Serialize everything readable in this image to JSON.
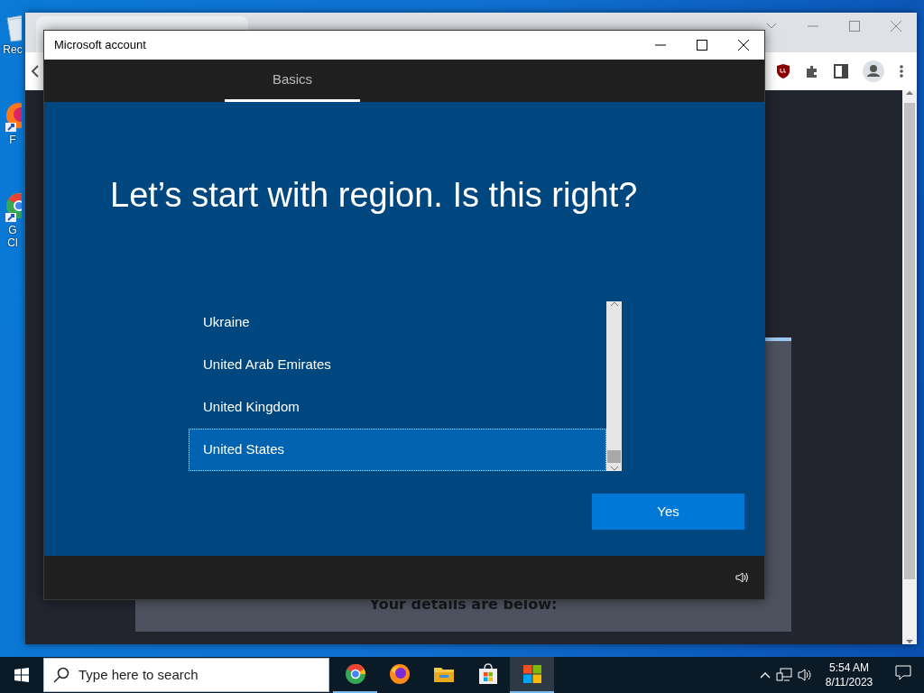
{
  "desktop_icons": [
    {
      "kind": "recycle",
      "lines": [
        "Rec"
      ]
    },
    {
      "kind": "firefox",
      "lines": [
        "F"
      ]
    },
    {
      "kind": "chrome",
      "lines": [
        "G",
        "Cl"
      ]
    }
  ],
  "browser_page": {
    "heading": "Your details are below:"
  },
  "dialog": {
    "title": "Microsoft account",
    "tabs": [
      {
        "label": "Basics",
        "selected": true
      }
    ],
    "heading": "Let’s start with region. Is this right?",
    "regions": [
      {
        "label": "Ukraine",
        "selected": false
      },
      {
        "label": "United Arab Emirates",
        "selected": false
      },
      {
        "label": "United Kingdom",
        "selected": false
      },
      {
        "label": "United States",
        "selected": true
      }
    ],
    "button": "Yes"
  },
  "taskbar": {
    "search": {
      "placeholder": "Type here to search"
    },
    "apps": [
      {
        "kind": "chrome",
        "running": true,
        "selected": false
      },
      {
        "kind": "firefox",
        "running": false,
        "selected": false
      },
      {
        "kind": "explorer",
        "running": false,
        "selected": false
      },
      {
        "kind": "store",
        "running": false,
        "selected": false
      },
      {
        "kind": "windows",
        "running": true,
        "selected": true
      }
    ],
    "time": "5:54 AM",
    "date": "8/11/2023"
  }
}
